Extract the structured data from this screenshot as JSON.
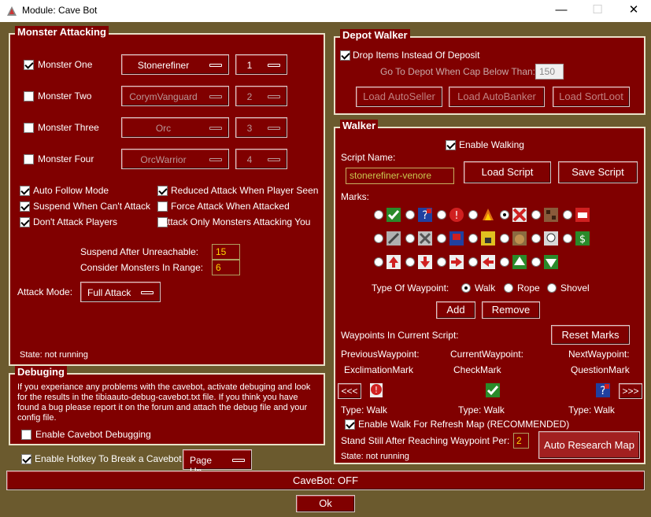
{
  "window": {
    "title": "Module: Cave Bot",
    "controls": {
      "minimize": "—",
      "maximize": "☐",
      "close": "✕"
    }
  },
  "monster_attacking": {
    "title": "Monster Attacking",
    "monsters": [
      {
        "label": "Monster One",
        "checked": true,
        "name": "Stonerefiner",
        "priority": "1",
        "enabled": true
      },
      {
        "label": "Monster Two",
        "checked": false,
        "name": "CorymVanguard",
        "priority": "2",
        "enabled": false
      },
      {
        "label": "Monster Three",
        "checked": false,
        "name": "Orc",
        "priority": "3",
        "enabled": false
      },
      {
        "label": "Monster Four",
        "checked": false,
        "name": "OrcWarrior",
        "priority": "4",
        "enabled": false
      }
    ],
    "options": {
      "auto_follow": {
        "label": "Auto Follow Mode",
        "checked": true
      },
      "reduced_attack": {
        "label": "Reduced Attack When Player Seen",
        "checked": true
      },
      "suspend_cant_attack": {
        "label": "Suspend When Can't Attack",
        "checked": true
      },
      "force_attack": {
        "label": "Force Attack When Attacked",
        "checked": false
      },
      "dont_attack_players": {
        "label": "Don't Attack Players",
        "checked": true
      },
      "only_attacking_you": {
        "label": "Attack Only Monsters Attacking You",
        "checked": false
      }
    },
    "suspend_after_unreachable": {
      "label": "Suspend After Unreachable:",
      "value": "15"
    },
    "consider_in_range": {
      "label": "Consider Monsters In Range:",
      "value": "6"
    },
    "attack_mode": {
      "label": "Attack Mode:",
      "value": "Full Attack"
    },
    "state": "State: not running"
  },
  "depot_walker": {
    "title": "Depot Walker",
    "drop_items": {
      "label": "Drop Items Instead Of Deposit",
      "checked": true
    },
    "go_to_depot": {
      "label": "Go To Depot When Cap Below Than:",
      "value": "150"
    },
    "buttons": {
      "auto_seller": "Load AutoSeller",
      "auto_banker": "Load AutoBanker",
      "sort_loot": "Load SortLoot"
    }
  },
  "walker": {
    "title": "Walker",
    "enable_walking": {
      "label": "Enable Walking",
      "checked": true
    },
    "script_name_label": "Script Name:",
    "script_name": "stonerefiner-venore",
    "load_script": "Load Script",
    "save_script": "Save Script",
    "marks_label": "Marks:",
    "type_of_waypoint_label": "Type Of Waypoint:",
    "waypoint_types": {
      "walk": "Walk",
      "rope": "Rope",
      "shovel": "Shovel"
    },
    "add": "Add",
    "remove": "Remove",
    "waypoints_label": "Waypoints In Current Script:",
    "reset_marks": "Reset Marks",
    "previous": {
      "label": "PreviousWaypoint:",
      "mark": "ExclimationMark",
      "type": "Type: Walk"
    },
    "current": {
      "label": "CurrentWaypoint:",
      "mark": "CheckMark",
      "type": "Type: Walk"
    },
    "next": {
      "label": "NextWaypoint:",
      "mark": "QuestionMark",
      "type": "Type: Walk"
    },
    "prev_btn": "<<<",
    "next_btn": ">>>",
    "enable_walk_refresh": {
      "label": "Enable Walk For Refresh Map (RECOMMENDED)",
      "checked": true
    },
    "stand_still": {
      "label": "Stand Still After Reaching Waypoint Per:",
      "value": "2"
    },
    "auto_research": "Auto Research Map",
    "state": "State: not running"
  },
  "debugging": {
    "title": "Debuging",
    "description": "If you experiance any problems with the cavebot, activate debuging and look for the results in the tibiaauto-debug-cavebot.txt file. If you think you have found a bug please report it on the forum and attach the debug file and your config file.",
    "enable": {
      "label": "Enable Cavebot Debugging",
      "checked": false
    }
  },
  "hotkey": {
    "label": "Enable Hotkey To Break a  Cavebot",
    "checked": true,
    "key": "Page Up"
  },
  "status_bar": "CaveBot: OFF",
  "ok": "Ok"
}
